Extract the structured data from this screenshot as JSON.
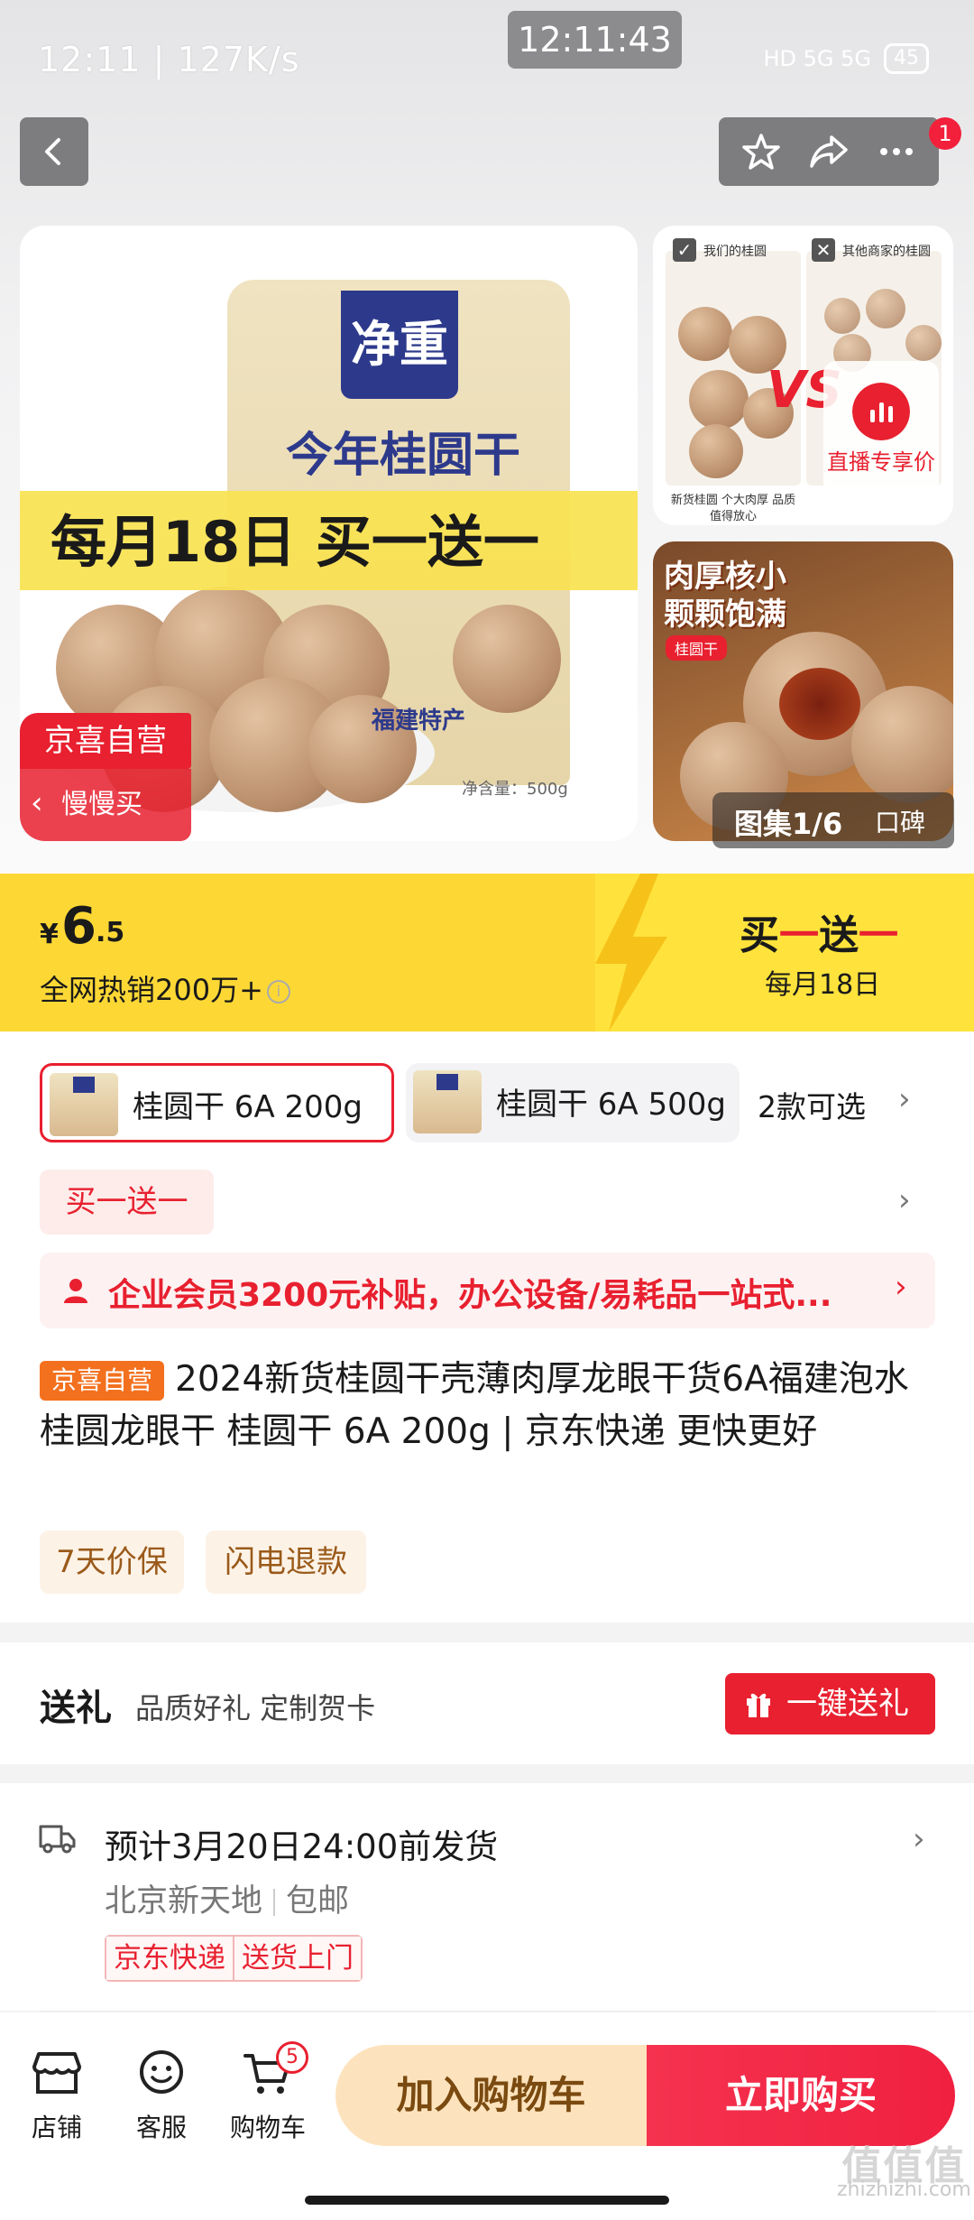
{
  "status_bar": {
    "left": "12:11 | 127K/s",
    "time_pill": "12:11:43",
    "network": "HD 5G 5G",
    "battery": "45"
  },
  "nav": {
    "badge": "1"
  },
  "main_image": {
    "bag_logo": "净重",
    "bag_title": "今年桂圆干",
    "promo_band": "每月18日 买一送一",
    "bag_foot": "福建特产",
    "bag_net": "净含量：500g",
    "jx_badge": "京喜自营",
    "slow_buy": "慢慢买"
  },
  "thumb_compare": {
    "left_head": "我们的桂圆",
    "right_head": "其他商家的桂圆",
    "vs": "VS",
    "left_foot": "新货桂圆 个大肉厚 品质值得放心"
  },
  "live": {
    "label": "直播专享价"
  },
  "thumb_meat": {
    "title": "肉厚核小颗颗饱满",
    "tag": "桂圆干"
  },
  "gallery": {
    "counter": "图集1/6",
    "reviews": "口碑"
  },
  "price": {
    "currency": "¥",
    "integer": "6",
    "decimal": ".5",
    "hot_sale": "全网热销200万+"
  },
  "bogo": {
    "title_a": "买",
    "title_b": "一",
    "title_c": "送",
    "title_d": "一",
    "subtitle": "每月18日"
  },
  "variants": {
    "items": [
      {
        "label": "桂圆干 6A 200g"
      },
      {
        "label": "桂圆干 6A 500g"
      }
    ],
    "count": "2款可选"
  },
  "promo_tag": "买一送一",
  "member_bar": "企业会员3200元补贴，办公设备/易耗品一站式...",
  "product": {
    "badge": "京喜自营",
    "title": "2024新货桂圆干壳薄肉厚龙眼干货6A福建泡水桂圆龙眼干 桂圆干 6A 200g | 京东快递 更快更好"
  },
  "service_tags": [
    "7天价保",
    "闪电退款"
  ],
  "gift": {
    "title": "送礼",
    "subtitle": "品质好礼 定制贺卡",
    "button": "一键送礼"
  },
  "shipping": {
    "estimate": "预计3月20日24:00前发货",
    "location": "北京新天地",
    "free_ship": "包邮",
    "tag1": "京东快递",
    "tag2": "送货上门"
  },
  "bottom_bar": {
    "shop": "店铺",
    "service": "客服",
    "cart": "购物车",
    "cart_count": "5",
    "add_to_cart": "加入购物车",
    "buy_now": "立即购买"
  },
  "watermark": {
    "big": "值值值",
    "small": "zhizhizhi.com"
  },
  "colors": {
    "accent_red": "#e8202f",
    "price_yellow": "#fdd835",
    "cart_bg": "#fde3bd"
  }
}
